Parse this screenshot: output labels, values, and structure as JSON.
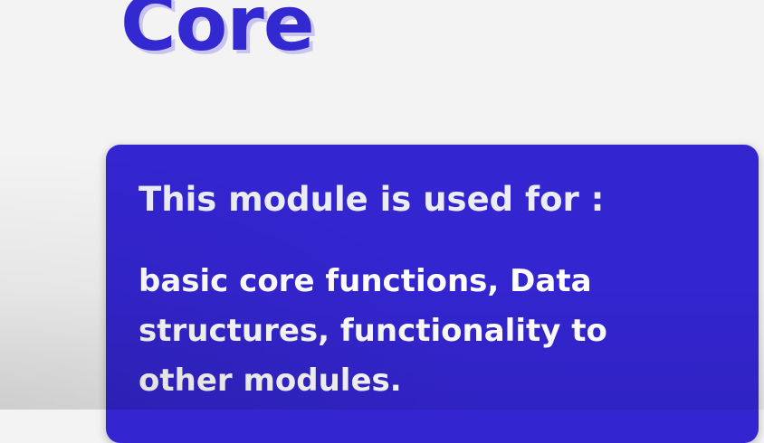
{
  "slide": {
    "title": "Core",
    "card": {
      "heading": "This module is used for :",
      "body_lines": [
        "basic core functions, Data",
        "structures, functionality to",
        "other modules."
      ]
    }
  }
}
